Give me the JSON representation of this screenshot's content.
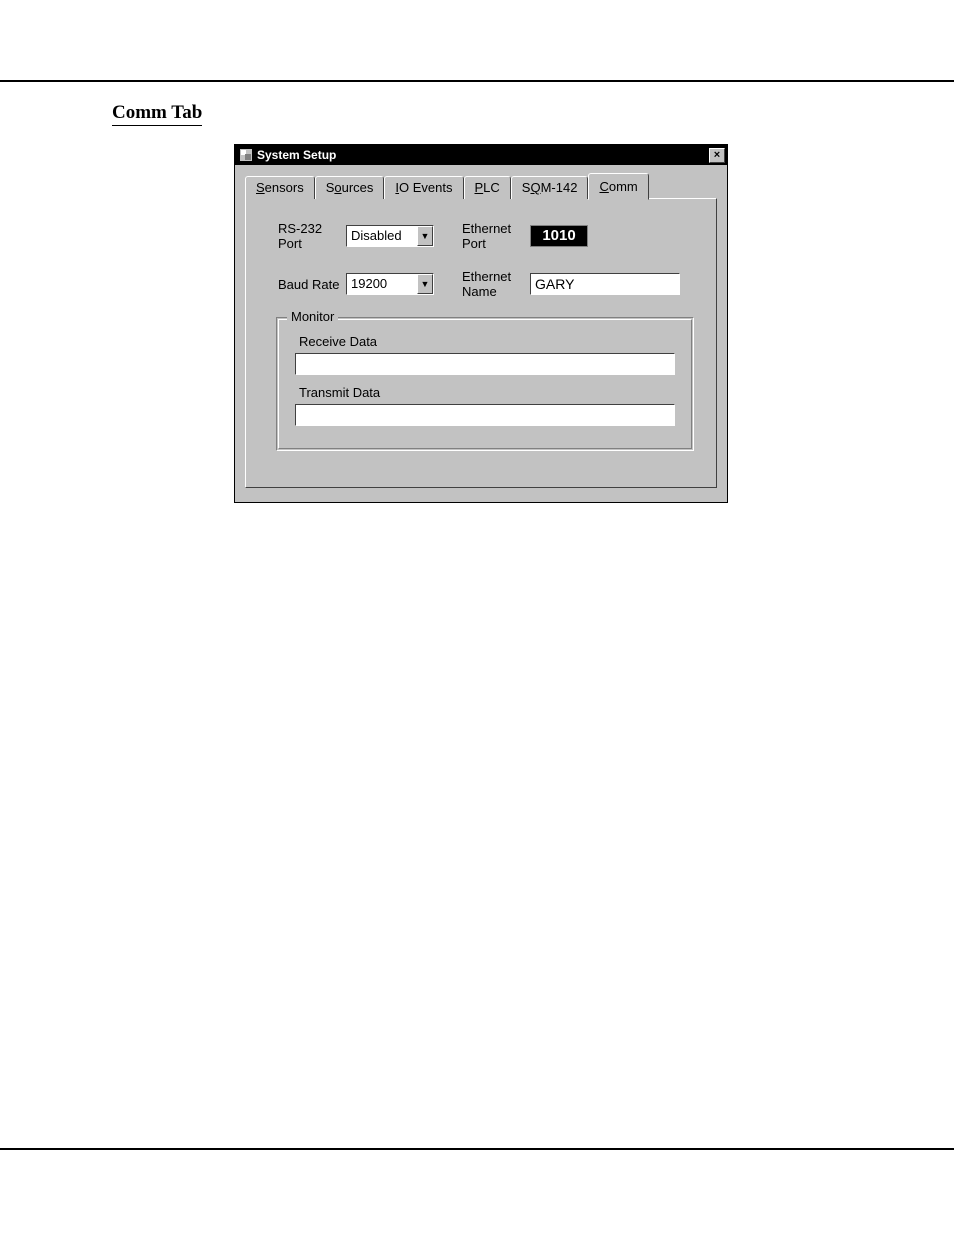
{
  "section_title": "Comm Tab",
  "dialog": {
    "title": "System Setup",
    "tabs": [
      "Sensors",
      "Sources",
      "IO Events",
      "PLC",
      "SQM-142",
      "Comm"
    ],
    "active_tab": 5,
    "comm": {
      "rs232_label": "RS-232 Port",
      "rs232_value": "Disabled",
      "baud_label": "Baud Rate",
      "baud_value": "19200",
      "eth_port_label": "Ethernet Port",
      "eth_port_value": "1010",
      "eth_name_label": "Ethernet Name",
      "eth_name_value": "GARY",
      "monitor": {
        "group_label": "Monitor",
        "receive_label": "Receive Data",
        "receive_value": "",
        "transmit_label": "Transmit Data",
        "transmit_value": ""
      }
    },
    "close_label": "×"
  }
}
